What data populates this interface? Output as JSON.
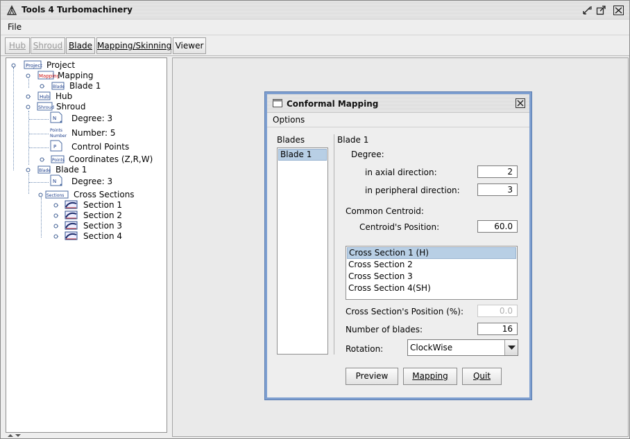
{
  "window": {
    "title": "Tools 4 Turbomachinery"
  },
  "menubar": {
    "file": "File"
  },
  "toolbar": {
    "hub": "Hub",
    "shroud": "Shroud",
    "blade": "Blade",
    "mapping": "Mapping/Skinning",
    "viewer": "Viewer"
  },
  "tree": {
    "project": "Project",
    "mapping": "Mapping",
    "mapping_blade1": "Blade 1",
    "hub": "Hub",
    "shroud": "Shroud",
    "shroud_degree": "Degree: 3",
    "shroud_number": "Number: 5",
    "shroud_control_points": "Control Points",
    "shroud_coordinates": "Coordinates (Z,R,W)",
    "blade1": "Blade 1",
    "blade1_degree": "Degree: 3",
    "cross_sections": "Cross Sections",
    "section1": "Section 1",
    "section2": "Section 2",
    "section3": "Section 3",
    "section4": "Section 4",
    "icon_labels": {
      "project": "Project",
      "mapping": "Mapping",
      "blade": "Blade",
      "hub": "Hub",
      "shroud": "Shroud",
      "points": "Points",
      "sections": "Sections"
    }
  },
  "dialog": {
    "title": "Conformal Mapping",
    "menu_options": "Options",
    "blades_header": "Blades",
    "blades_list": [
      "Blade 1"
    ],
    "blade_heading": "Blade 1",
    "degree_label": "Degree:",
    "axial_label": "in axial direction:",
    "axial_value": "2",
    "peripheral_label": "in peripheral direction:",
    "peripheral_value": "3",
    "centroid_heading": "Common Centroid:",
    "centroid_label": "Centroid's Position:",
    "centroid_value": "60.0",
    "cross_sections": [
      "Cross Section 1 (H)",
      "Cross Section 2",
      "Cross Section 3",
      "Cross Section 4(SH)"
    ],
    "cs_position_label": "Cross Section's Position (%):",
    "cs_position_value": "0.0",
    "num_blades_label": "Number of blades:",
    "num_blades_value": "16",
    "rotation_label": "Rotation:",
    "rotation_value": "ClockWise",
    "preview_button": "Preview",
    "mapping_button": "Mapping",
    "quit_button": "Quit"
  },
  "colors": {
    "selection": "#b8cfe5",
    "dialog_border": "#7e9fd0",
    "tree_line": "#6e8cb4"
  }
}
